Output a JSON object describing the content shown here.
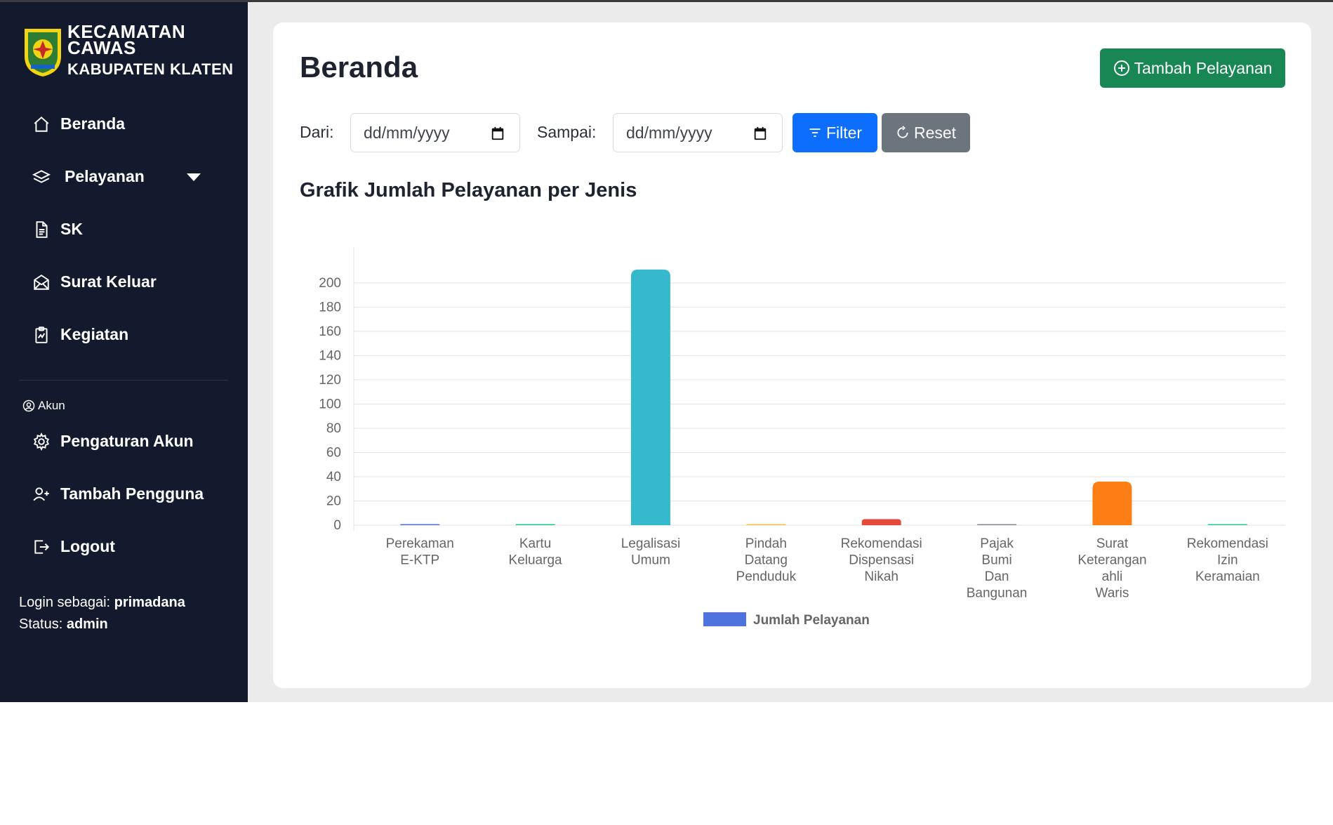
{
  "sidebar": {
    "brand_line1": "KECAMATAN",
    "brand_line2": "CAWAS",
    "brand_line3": "KABUPATEN KLATEN",
    "nav": [
      {
        "label": "Beranda",
        "icon": "home-icon"
      },
      {
        "label": "Pelayanan",
        "icon": "layers-icon",
        "has_dropdown": true
      },
      {
        "label": "SK",
        "icon": "document-icon"
      },
      {
        "label": "Surat Keluar",
        "icon": "envelope-icon"
      },
      {
        "label": "Kegiatan",
        "icon": "clipboard-icon"
      }
    ],
    "section_label": "Akun",
    "account_nav": [
      {
        "label": "Pengaturan Akun",
        "icon": "gear-icon"
      },
      {
        "label": "Tambah Pengguna",
        "icon": "add-user-icon"
      },
      {
        "label": "Logout",
        "icon": "logout-icon"
      }
    ],
    "login_prefix": "Login sebagai:",
    "login_user": "primadana",
    "status_prefix": "Status:",
    "status_value": "admin"
  },
  "main": {
    "title": "Beranda",
    "add_button": "Tambah Pelayanan",
    "filter": {
      "from_label": "Dari:",
      "from_placeholder": "dd/mm/yyyy",
      "to_label": "Sampai:",
      "to_placeholder": "dd/mm/yyyy",
      "filter_button": "Filter",
      "reset_button": "Reset"
    },
    "chart_title": "Grafik Jumlah Pelayanan per Jenis"
  },
  "colors": {
    "sidebar_bg": "#141a2e",
    "primary": "#0d6efd",
    "success": "#198754",
    "secondary": "#6c757d"
  },
  "chart_data": {
    "type": "bar",
    "title": "Grafik Jumlah Pelayanan per Jenis",
    "categories": [
      [
        "Perekaman",
        "E-KTP"
      ],
      [
        "Kartu",
        "Keluarga"
      ],
      [
        "Legalisasi",
        "Umum"
      ],
      [
        "Pindah",
        "Datang",
        "Penduduk"
      ],
      [
        "Rekomendasi",
        "Dispensasi",
        "Nikah"
      ],
      [
        "Pajak",
        "Bumi",
        "Dan",
        "Bangunan"
      ],
      [
        "Surat",
        "Keterangan",
        "ahli",
        "Waris"
      ],
      [
        "Rekomendasi",
        "Izin",
        "Keramaian"
      ]
    ],
    "series": [
      {
        "name": "Jumlah Pelayanan",
        "values": [
          0,
          0,
          211,
          0,
          5,
          0,
          36,
          0
        ],
        "colors": [
          "#4e73df",
          "#1cc88a",
          "#36b9cc",
          "#f6c23e",
          "#e74a3b",
          "#858796",
          "#fd7e14",
          "#20c997"
        ]
      }
    ],
    "yticks": [
      0,
      20,
      40,
      60,
      80,
      100,
      120,
      140,
      160,
      180,
      200
    ],
    "ylim": [
      0,
      215
    ],
    "legend_position": "bottom",
    "legend_color": "#4e73df",
    "grid": true
  }
}
